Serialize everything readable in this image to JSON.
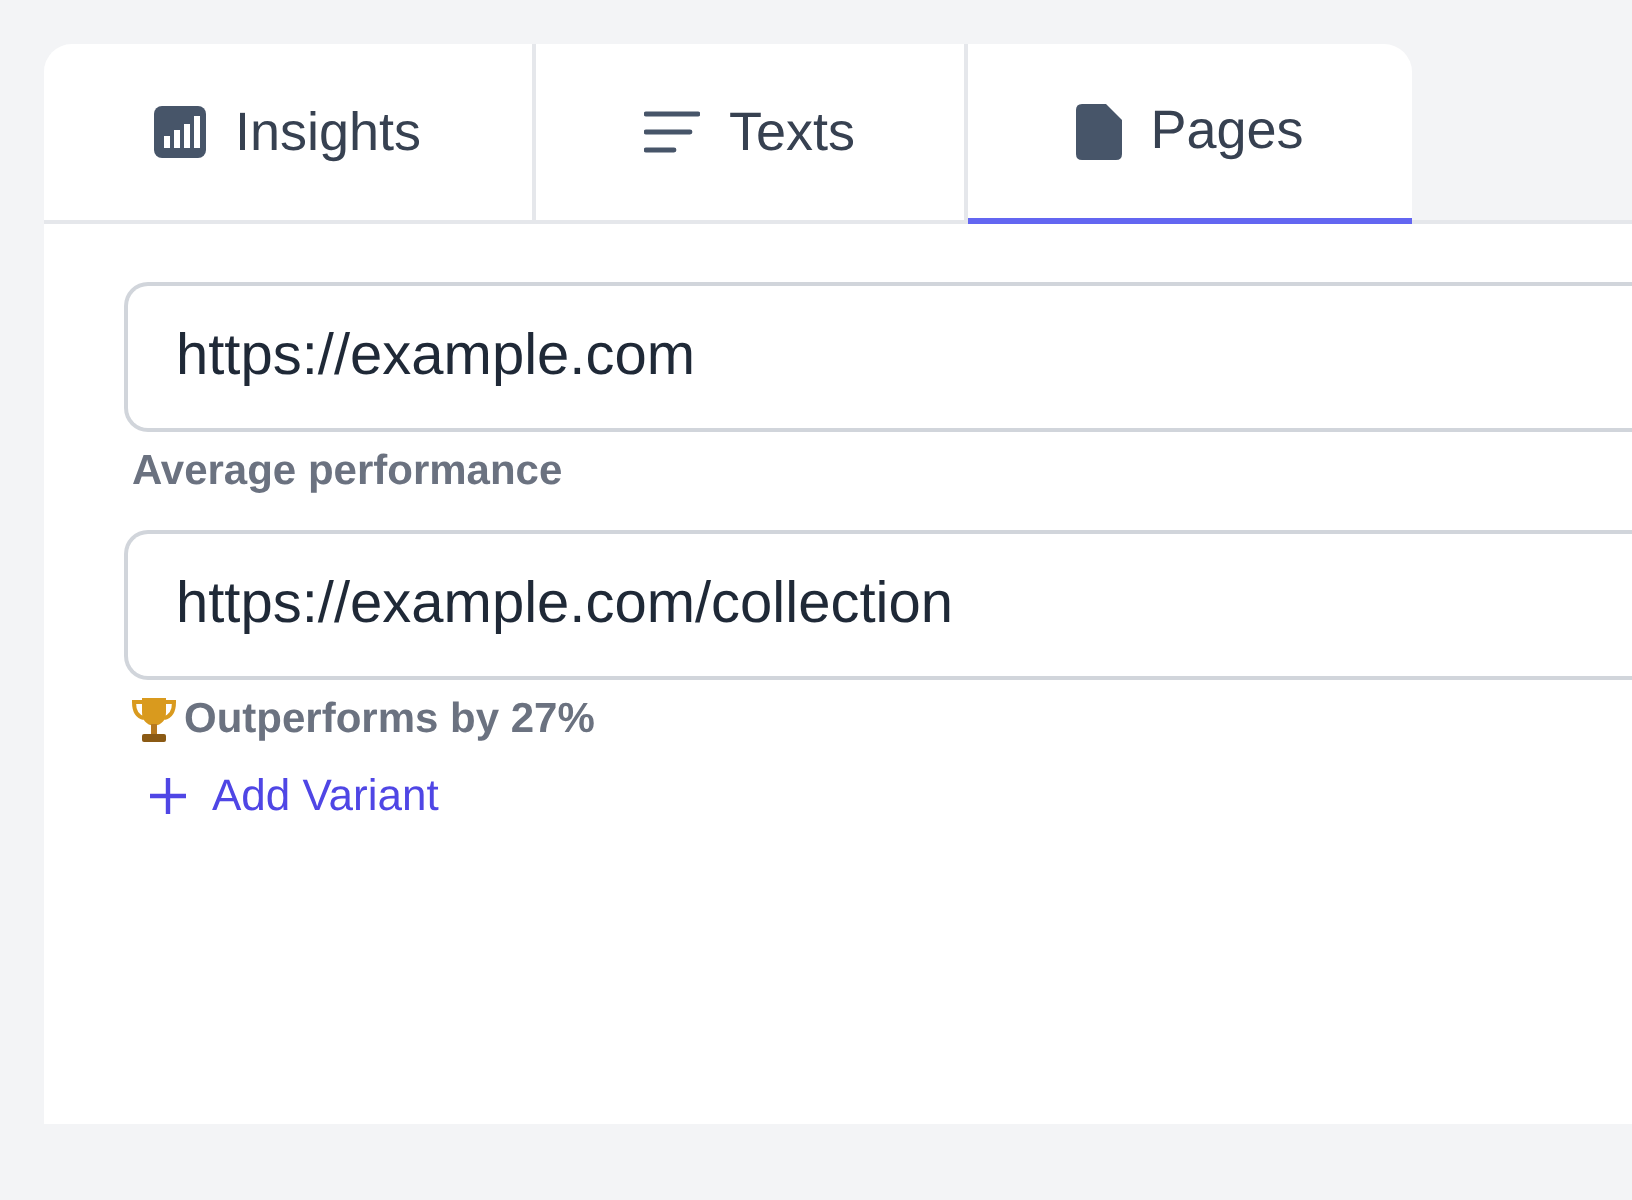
{
  "tabs": [
    {
      "label": "Insights",
      "kind": "chart",
      "selected": false
    },
    {
      "label": "Texts",
      "kind": "lines",
      "selected": false
    },
    {
      "label": "Pages",
      "kind": "file",
      "selected": true
    }
  ],
  "variants": [
    {
      "value": "https://example.com",
      "note": "Average performance",
      "winner": false
    },
    {
      "value": "https://example.com/collection",
      "note": "Outperforms by 27%",
      "winner": true
    }
  ],
  "add_button": "Add Variant"
}
